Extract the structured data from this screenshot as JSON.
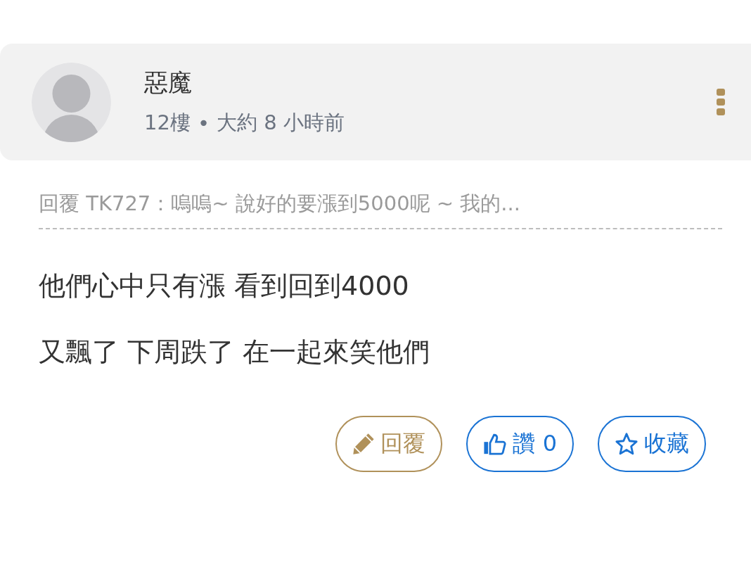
{
  "post": {
    "author": "惡魔",
    "floor": "12樓",
    "separator": "•",
    "time": "大約 8 小時前"
  },
  "quote": "回覆 TK727：嗚嗚~ 說好的要漲到5000呢 ~ 我的...",
  "body": [
    "他們心中只有漲 看到回到4000",
    "又飄了 下周跌了 在一起來笑他們"
  ],
  "actions": [
    {
      "kind": "reply",
      "label": "回覆"
    },
    {
      "kind": "like",
      "label": "讚 0"
    },
    {
      "kind": "favorite",
      "label": "收藏"
    }
  ]
}
